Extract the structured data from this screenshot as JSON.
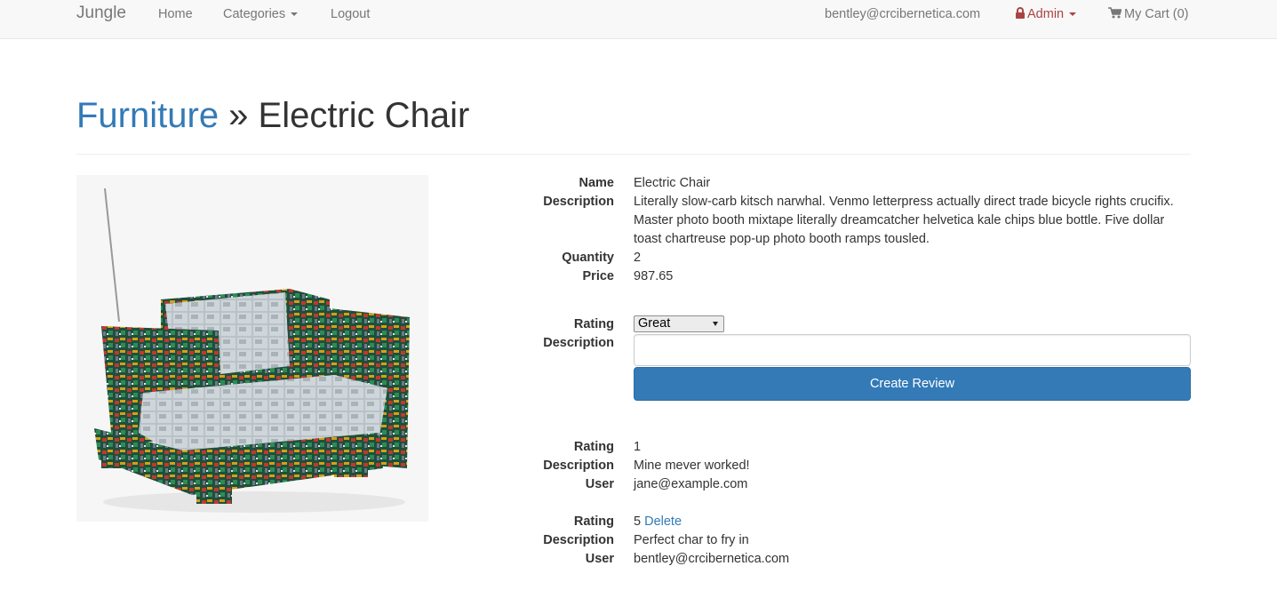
{
  "navbar": {
    "brand": "Jungle",
    "home": "Home",
    "categories": "Categories",
    "logout": "Logout",
    "user_email": "bentley@crcibernetica.com",
    "admin": "Admin",
    "cart": "My Cart (0)"
  },
  "header": {
    "category": "Furniture",
    "separator": " » ",
    "product": "Electric Chair"
  },
  "details": {
    "name_label": "Name",
    "name": "Electric Chair",
    "description_label": "Description",
    "description": "Literally slow-carb kitsch narwhal. Venmo letterpress actually direct trade bicycle rights crucifix. Master photo booth mixtape literally dreamcatcher helvetica kale chips blue bottle. Five dollar toast chartreuse pop-up photo booth ramps tousled.",
    "quantity_label": "Quantity",
    "quantity": "2",
    "price_label": "Price",
    "price": "987.65"
  },
  "review_form": {
    "rating_label": "Rating",
    "rating_value": "Great",
    "description_label": "Description",
    "description_value": "",
    "submit_label": "Create Review"
  },
  "reviews": [
    {
      "rating_label": "Rating",
      "rating": "1",
      "description_label": "Description",
      "description": "Mine mever worked!",
      "user_label": "User",
      "user": "jane@example.com"
    },
    {
      "rating_label": "Rating",
      "rating": "5",
      "delete_label": "Delete",
      "description_label": "Description",
      "description": "Perfect char to fry in",
      "user_label": "User",
      "user": "bentley@crcibernetica.com"
    }
  ],
  "colors": {
    "link": "#337ab7",
    "admin": "#a94442",
    "navbar_bg": "#f8f8f8",
    "button": "#337ab7"
  },
  "icons": {
    "admin": "lock-icon",
    "cart": "shopping-cart-icon"
  }
}
